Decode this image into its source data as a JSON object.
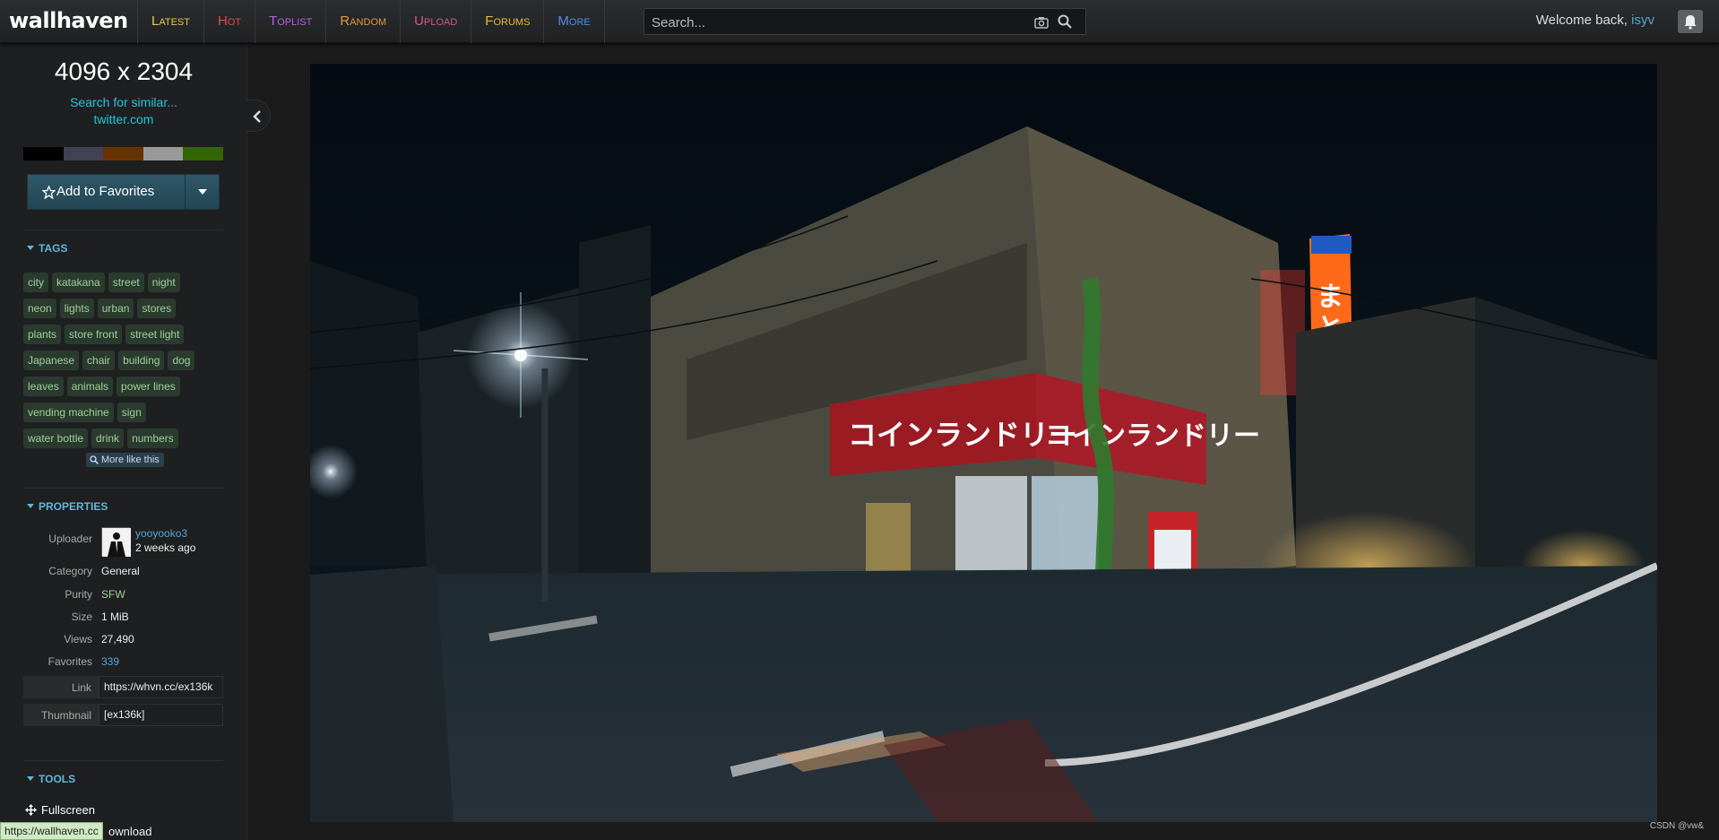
{
  "topbar": {
    "logo": "wallhaven",
    "nav": [
      {
        "label": "Latest",
        "color": "#e3c84f"
      },
      {
        "label": "Hot",
        "color": "#e14a4a"
      },
      {
        "label": "Toplist",
        "color": "#b55fe6"
      },
      {
        "label": "Random",
        "color": "#e8943f"
      },
      {
        "label": "Upload",
        "color": "#d45a7f"
      },
      {
        "label": "Forums",
        "color": "#e8bb3d"
      },
      {
        "label": "More",
        "color": "#4f8ee8"
      }
    ],
    "search_placeholder": "Search...",
    "welcome_text": "Welcome back,",
    "username": "isyv",
    "icons": {
      "camera": "camera-icon",
      "search": "search-icon",
      "bell": "bell-icon"
    }
  },
  "sidebar": {
    "resolution": "4096 x 2304",
    "search_similar": "Search for similar...",
    "source": "twitter.com",
    "palette": [
      "#000000",
      "#424153",
      "#663300",
      "#999999",
      "#336600"
    ],
    "favorites_label": "Add to Favorites",
    "tags_heading": "TAGS",
    "tags": [
      [
        "city",
        "katakana",
        "street",
        "night"
      ],
      [
        "neon",
        "lights",
        "urban",
        "stores"
      ],
      [
        "plants",
        "store front",
        "street light"
      ],
      [
        "Japanese",
        "chair",
        "building",
        "dog"
      ],
      [
        "leaves",
        "animals",
        "power lines"
      ],
      [
        "vending machine",
        "sign"
      ],
      [
        "water bottle",
        "drink",
        "numbers"
      ]
    ],
    "more_like_this": "More like this",
    "properties_heading": "PROPERTIES",
    "uploader": {
      "label": "Uploader",
      "name": "yooyooko3",
      "time": "2 weeks ago"
    },
    "properties": [
      {
        "key": "Category",
        "value": "General",
        "color": "#eeeeee"
      },
      {
        "key": "Purity",
        "value": "SFW",
        "color": "#9fd09a"
      },
      {
        "key": "Size",
        "value": "1 MiB",
        "color": "#eeeeee"
      },
      {
        "key": "Views",
        "value": "27,490",
        "color": "#eeeeee"
      },
      {
        "key": "Favorites",
        "value": "339",
        "color": "#4fa8d8"
      }
    ],
    "link": {
      "label": "Link",
      "value": "https://whvn.cc/ex136k"
    },
    "thumbnail": {
      "label": "Thumbnail",
      "value": "[ex136k]"
    },
    "tools_heading": "TOOLS",
    "tools": {
      "fullscreen": "Fullscreen",
      "download_partial": "ownload"
    }
  },
  "statusbar": "https://wallhaven.cc",
  "watermark": "CSDN @vw&"
}
